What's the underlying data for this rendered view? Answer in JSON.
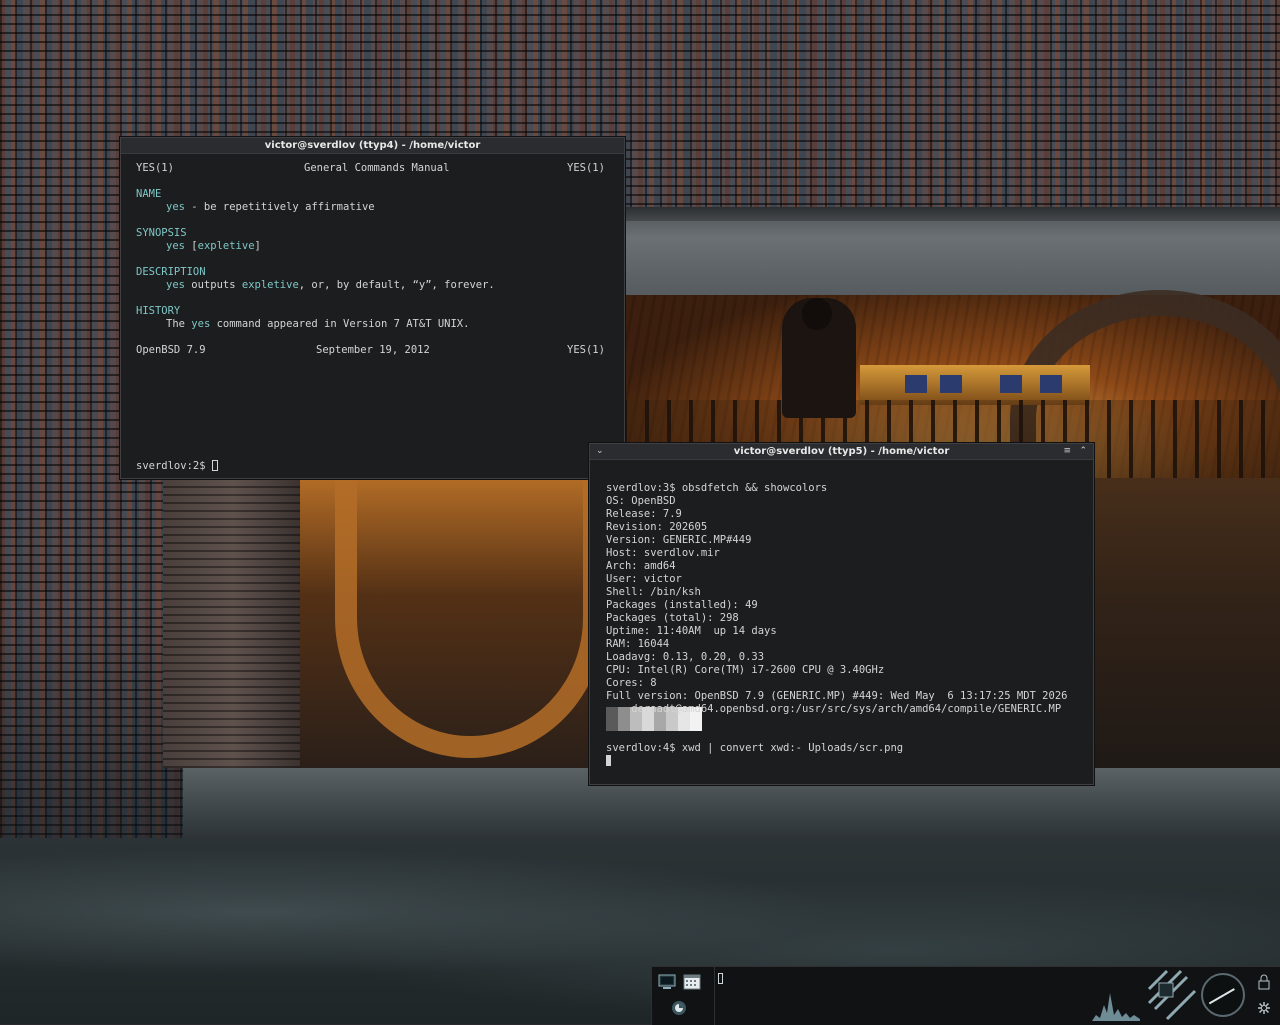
{
  "colors": {
    "terminal_bg": "#1c1d1f",
    "terminal_fg": "#d4d4d4",
    "accent": "#7fc7c7",
    "titlebar_bg": "#2b2c2f",
    "panel_bg": "#111213"
  },
  "window_left": {
    "title": "victor@sverdlov (ttyp4) - /home/victor",
    "man": {
      "header_left": "YES(1)",
      "header_center": "General Commands Manual",
      "header_right": "YES(1)",
      "name_heading": "NAME",
      "name_cmd": "yes",
      "name_desc": " - be repetitively affirmative",
      "synopsis_heading": "SYNOPSIS",
      "synopsis_cmd": "yes",
      "synopsis_arg_open": " [",
      "synopsis_arg": "expletive",
      "synopsis_arg_close": "]",
      "description_heading": "DESCRIPTION",
      "desc_cmd": "yes",
      "desc_text1": " outputs ",
      "desc_arg": "expletive",
      "desc_text2": ", or, by default, “y”, forever.",
      "history_heading": "HISTORY",
      "hist_text1": "The ",
      "hist_cmd": "yes",
      "hist_text2": " command appeared in Version 7 AT&T UNIX.",
      "footer_left": "OpenBSD 7.9",
      "footer_center": "September 19, 2012",
      "footer_right": "YES(1)"
    },
    "prompt": "sverdlov:2$ "
  },
  "window_right": {
    "title": "victor@sverdlov (ttyp5) - /home/victor",
    "menu_icon": "chevron-down-icon",
    "lines": [
      "sverdlov:3$ obsdfetch && showcolors",
      "OS: OpenBSD",
      "Release: 7.9",
      "Revision: 202605",
      "Version: GENERIC.MP#449",
      "Host: sverdlov.mir",
      "Arch: amd64",
      "User: victor",
      "Shell: /bin/ksh",
      "Packages (installed): 49",
      "Packages (total): 298",
      "Uptime: 11:40AM  up 14 days",
      "RAM: 16044",
      "Loadavg: 0.13, 0.20, 0.33",
      "CPU: Intel(R) Core(TM) i7-2600 CPU @ 3.40GHz",
      "Cores: 8",
      "Full version: OpenBSD 7.9 (GENERIC.MP) #449: Wed May  6 13:17:25 MDT 2026",
      "    deraadt@amd64.openbsd.org:/usr/src/sys/arch/amd64/compile/GENERIC.MP"
    ],
    "swatch_colors": [
      "#5a5a5a",
      "#8e8e8e",
      "#bdbdbd",
      "#d9d9d9",
      "#a8a8a8",
      "#c9c9c9",
      "#e6e6e6",
      "#f2f2f2"
    ],
    "last_command": "sverdlov:4$ xwd | convert xwd:- Uploads/scr.png"
  },
  "panel": {
    "icons": [
      "terminal-icon",
      "calendar-icon",
      "firefox-icon",
      "network-icon",
      "clock-icon",
      "lock-icon",
      "settings-icon"
    ]
  }
}
